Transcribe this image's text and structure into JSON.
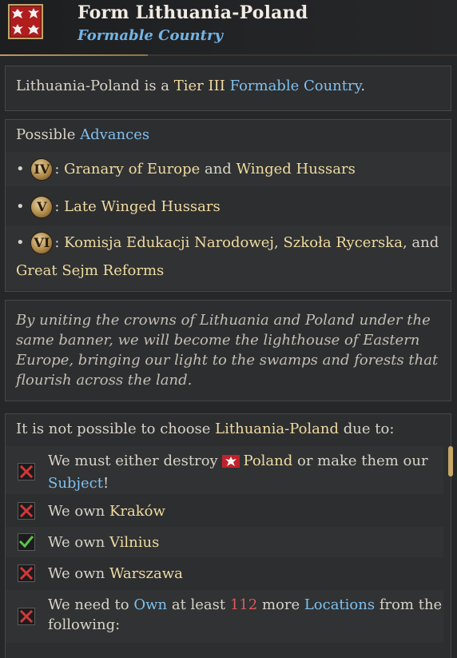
{
  "header": {
    "title": "Form Lithuania-Poland",
    "subtitle": "Formable Country"
  },
  "summary": {
    "prefix": "Lithuania-Poland is a ",
    "tier": "Tier III",
    "space": " ",
    "link": "Formable Country",
    "suffix": "."
  },
  "advances": {
    "head_prefix": "Possible ",
    "head_link": "Advances",
    "rows": [
      {
        "bullet": "•",
        "numeral": "IV",
        "sep": ": ",
        "a": "Granary of Europe",
        "and": " and ",
        "b": "Winged Hussars"
      },
      {
        "bullet": "•",
        "numeral": "V",
        "sep": ": ",
        "a": "Late Winged Hussars"
      },
      {
        "bullet": "•",
        "numeral": "VI",
        "sep": ": ",
        "a": "Komisja Edukacji Narodowej",
        "comma1": ", ",
        "b": "Szkoła Rycerska",
        "and": ", and",
        "c": "Great Sejm Reforms"
      }
    ]
  },
  "flavor": {
    "text": "By uniting the crowns of Lithuania and Poland under the same banner, we will become the lighthouse of Eastern Europe, bringing our light to the swamps and forests that flourish across the land."
  },
  "requirements": {
    "head_prefix": "It is not possible to choose ",
    "head_name": "Lithuania-Poland",
    "head_suffix": " due to:",
    "items": [
      {
        "status": "fail",
        "t1": "We must either destroy ",
        "country": "Poland",
        "t2": " or make them our",
        "link": "Subject",
        "t3": "!"
      },
      {
        "status": "fail",
        "t1": "We own ",
        "place": "Kraków"
      },
      {
        "status": "ok",
        "t1": "We own ",
        "place": "Vilnius"
      },
      {
        "status": "fail",
        "t1": "We own ",
        "place": "Warszawa"
      },
      {
        "status": "fail",
        "t1": "We need to ",
        "link1": "Own",
        "t2": " at least ",
        "num": "112",
        "t3": " more ",
        "link2": "Locations",
        "t4": " from the",
        "t5": "following:"
      }
    ]
  },
  "colors": {
    "gold": "#f0dba0",
    "link": "#7fc0ee",
    "negative": "#e0575a",
    "fail_mark": "#d2373a",
    "ok_mark": "#5cc34a"
  },
  "icons": {
    "flag": "lithuania-poland-coat-of-arms-icon",
    "fail": "red-x-checkbox-icon",
    "ok": "green-check-checkbox-icon",
    "poland": "poland-eagle-flag-icon"
  }
}
